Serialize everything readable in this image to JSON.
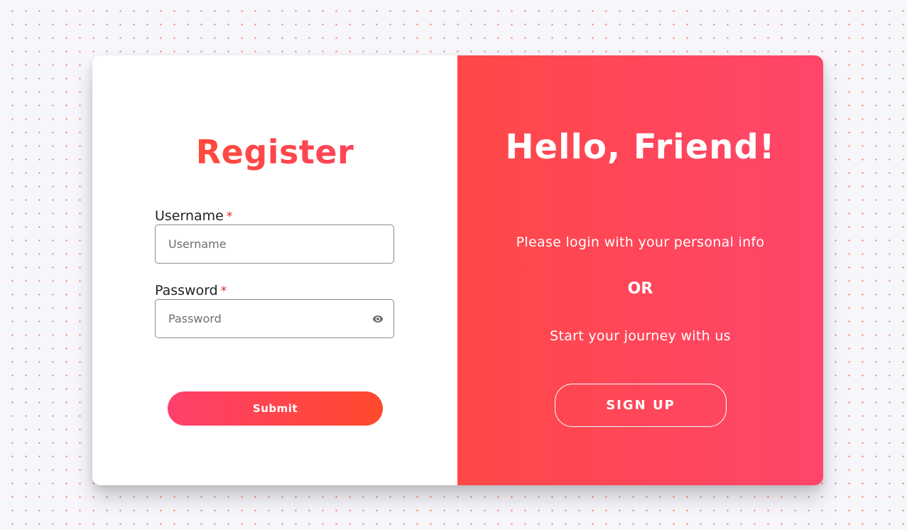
{
  "register": {
    "title": "Register",
    "username_label": "Username",
    "username_placeholder": "Username",
    "username_value": "",
    "password_label": "Password",
    "password_placeholder": "Password",
    "password_value": "",
    "required_marker": "*",
    "password_toggle_icon": "eye-icon",
    "submit_label": "Submit"
  },
  "welcome": {
    "title": "Hello, Friend!",
    "login_text": "Please login with your personal info",
    "or_text": "OR",
    "journey_text": "Start your journey with us",
    "signup_label": "SIGN UP"
  },
  "colors": {
    "page_background": "#f6f6fb",
    "dot_pattern": "#f0815f",
    "accent_orange": "#ff4e2b",
    "accent_pink": "#ff456a",
    "panel_gradient_start": "#ff4848",
    "panel_gradient_end": "#ff456a",
    "required_star": "#e02020"
  }
}
